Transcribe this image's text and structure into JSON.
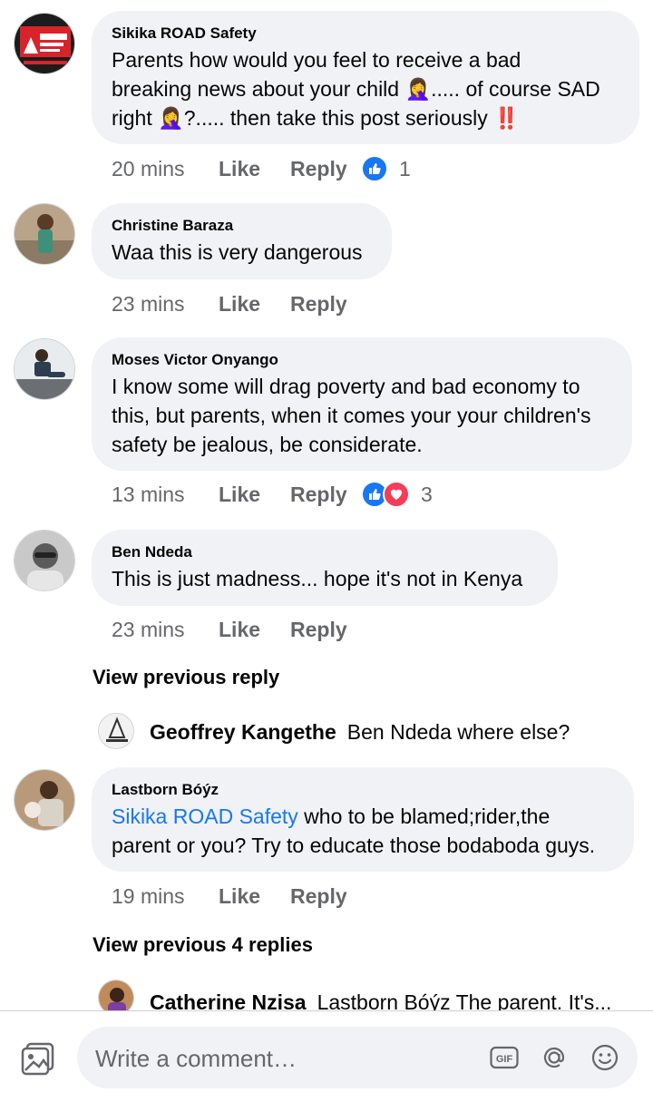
{
  "comments": [
    {
      "author": "Sikika ROAD Safety",
      "text_lines": [
        "Parents how would you feel to receive a bad",
        "breaking news about your child 🤦‍♀️..... of course SAD",
        "right 🤦‍♀️?..... then take this post seriously ‼️"
      ],
      "time": "20 mins",
      "like": "Like",
      "reply": "Reply",
      "reaction_count": "1"
    },
    {
      "author": "Christine Baraza",
      "text_lines": [
        "Waa this is very dangerous"
      ],
      "time": "23 mins",
      "like": "Like",
      "reply": "Reply"
    },
    {
      "author": "Moses Victor Onyango",
      "text_lines": [
        "I know some will drag poverty and bad economy to",
        "this, but parents, when it comes your your children's",
        "safety be jealous, be considerate."
      ],
      "time": "13 mins",
      "like": "Like",
      "reply": "Reply",
      "reaction_count": "3"
    },
    {
      "author": "Ben Ndeda",
      "text_lines": [
        "This is just madness... hope it's not in Kenya"
      ],
      "time": "23 mins",
      "like": "Like",
      "reply": "Reply"
    },
    {
      "author": "Lastborn Bóýz",
      "mention": "Sikika ROAD Safety",
      "text_line1_rest": " who to be blamed;rider,the",
      "text_line2": "parent or you? Try to educate those bodaboda guys.",
      "time": "19 mins",
      "like": "Like",
      "reply": "Reply"
    }
  ],
  "view_previous_1": "View previous reply",
  "reply_preview_1": {
    "author": "Geoffrey Kangethe",
    "text": "Ben Ndeda where else?"
  },
  "view_previous_2": "View previous 4 replies",
  "reply_preview_2": {
    "author": "Catherine Nzisa",
    "text": "Lastborn Bóýz The parent. It's..."
  },
  "composer": {
    "placeholder": "Write a comment…",
    "gif_label": "GIF"
  },
  "colors": {
    "link": "#1877f2",
    "bubble": "#f0f2f5",
    "meta": "#65676b",
    "love": "#f33e58"
  }
}
